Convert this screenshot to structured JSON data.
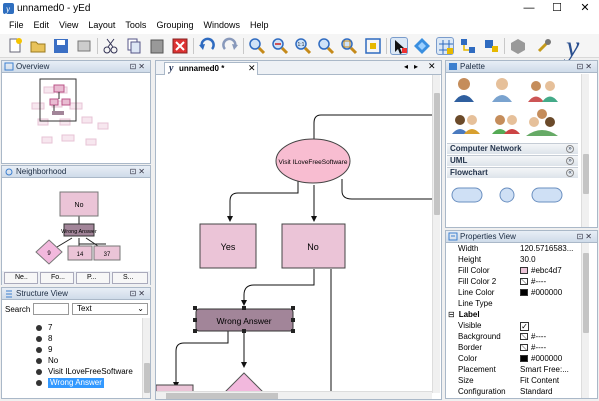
{
  "window": {
    "title": "unnamed0 - yEd",
    "controls": [
      "—",
      "☐",
      "✕"
    ]
  },
  "menu": [
    "File",
    "Edit",
    "View",
    "Layout",
    "Tools",
    "Grouping",
    "Windows",
    "Help"
  ],
  "toolbar": {
    "icons": [
      "new-icon",
      "open-icon",
      "save-icon",
      "properties-icon",
      "cut-icon",
      "copy-icon",
      "paste-icon",
      "delete-icon",
      "undo-icon",
      "redo-icon",
      "zoom-in-icon",
      "zoom-out-icon",
      "zoom-original-icon",
      "zoom-fit-icon",
      "zoom-area-icon",
      "fit-content-icon",
      "edit-mode-icon",
      "navigate-icon",
      "grid-icon",
      "ortho-icon",
      "snaplines-icon",
      "group-icon",
      "plugin-icon",
      "yed-logo"
    ]
  },
  "overview": {
    "title": "Overview"
  },
  "neighborhood": {
    "title": "Neighborhood",
    "nodes": {
      "no": "No",
      "wrong": "Wrong Answer",
      "n9": "9",
      "n14": "14",
      "n37": "37"
    },
    "tabs": [
      "Ne..",
      "Fo...",
      "P...",
      "S..."
    ]
  },
  "structure": {
    "title": "Structure View",
    "search_label": "Search",
    "search_value": "",
    "mode": "Text",
    "items": [
      "7",
      "8",
      "9",
      "No",
      "Visit ILoveFreeSoftware",
      "Wrong Answer"
    ],
    "selected_index": 5
  },
  "editor": {
    "tab_label": "unnamed0 *",
    "nodes": {
      "start": "Visit ILoveFreeSoftware",
      "yes": "Yes",
      "no": "No",
      "wrong": "Wrong Answer"
    }
  },
  "palette": {
    "title": "Palette",
    "sections": [
      "Computer Network",
      "UML",
      "Flowchart"
    ]
  },
  "properties": {
    "title": "Properties View",
    "rows": [
      {
        "key": "Width",
        "value": "120.5716583..."
      },
      {
        "key": "Height",
        "value": "30.0"
      },
      {
        "key": "Fill Color",
        "value": "#ebc4d7",
        "swatch": "#ebc4d7"
      },
      {
        "key": "Fill Color 2",
        "value": "#----",
        "swatch": "x"
      },
      {
        "key": "Line Color",
        "value": "#000000",
        "swatch": "#000000"
      },
      {
        "key": "Line Type",
        "value": ""
      }
    ],
    "label_section": "Label",
    "label_rows": [
      {
        "key": "Visible",
        "value": "",
        "check": true
      },
      {
        "key": "Background",
        "value": "#----",
        "swatch": "x"
      },
      {
        "key": "Border",
        "value": "#----",
        "swatch": "x"
      },
      {
        "key": "Color",
        "value": "#000000",
        "swatch": "#000000"
      },
      {
        "key": "Placement",
        "value": "Smart Free:..."
      },
      {
        "key": "Size",
        "value": "Fit Content"
      },
      {
        "key": "Configuration",
        "value": "Standard"
      }
    ]
  },
  "colors": {
    "accent": "#3c7fcf",
    "node_pink": "#ebc4d7",
    "node_purple": "#a28599",
    "node_magenta": "#f2b8dd",
    "selection": "#3399ff"
  }
}
